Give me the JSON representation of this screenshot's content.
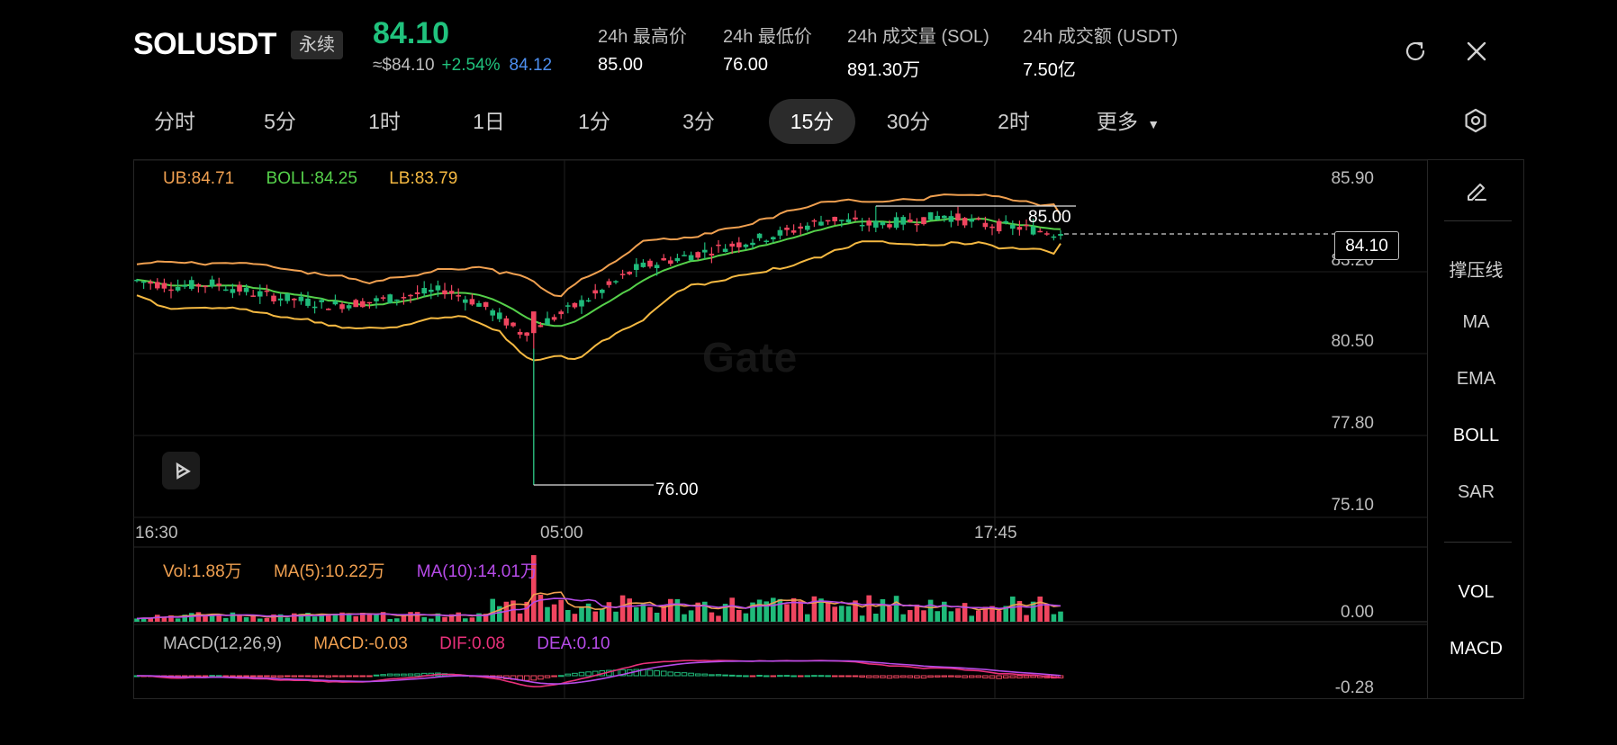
{
  "header": {
    "symbol": "SOLUSDT",
    "contract_type": "永续",
    "last_price": "84.10",
    "usd_price": "≈$84.10",
    "change_pct": "+2.54%",
    "mark_price": "84.12",
    "stats": [
      {
        "label": "24h 最高价",
        "value": "85.00"
      },
      {
        "label": "24h 最低价",
        "value": "76.00"
      },
      {
        "label": "24h 成交量 (SOL)",
        "value": "891.30万"
      },
      {
        "label": "24h 成交额 (USDT)",
        "value": "7.50亿"
      }
    ],
    "icons": [
      "rotate-icon",
      "close-icon"
    ]
  },
  "intervals": [
    "分时",
    "5分",
    "1时",
    "1日",
    "1分",
    "3分",
    "15分",
    "30分",
    "2时",
    "更多"
  ],
  "active_interval": "15分",
  "settings_icon": "hexagon-gear-icon",
  "indicator_panel": {
    "edit_icon": "pencil-icon",
    "main": [
      "撑压线",
      "MA",
      "EMA",
      "BOLL",
      "SAR"
    ],
    "main_active": "BOLL",
    "sub": [
      "VOL",
      "MACD"
    ]
  },
  "main_chart": {
    "legend": {
      "ub": "UB:84.71",
      "boll": "BOLL:84.25",
      "lb": "LB:83.79"
    },
    "y_ticks": [
      "85.90",
      "83.20",
      "80.50",
      "77.80",
      "75.10"
    ],
    "x_ticks": [
      "16:30",
      "05:00",
      "17:45"
    ],
    "last_price_tag": "84.10",
    "high_label": "85.00",
    "low_label": "76.00",
    "watermark": "Gate"
  },
  "volume_panel": {
    "legend": {
      "vol": "Vol:1.88万",
      "ma5": "MA(5):10.22万",
      "ma10": "MA(10):14.01万"
    },
    "y_tick": "0.00"
  },
  "macd_panel": {
    "legend": {
      "title": "MACD(12,26,9)",
      "macd": "MACD:-0.03",
      "dif": "DIF:0.08",
      "dea": "DEA:0.10"
    },
    "y_tick": "-0.28"
  },
  "colors": {
    "up": "#1fba7a",
    "down": "#f0455f",
    "ub": "#f0a050",
    "boll": "#55d04a",
    "lb": "#f5b942",
    "ma10": "#b64be8",
    "dif": "#e8307a"
  },
  "chart_data": {
    "type": "candlestick",
    "ylim": [
      75.1,
      85.9
    ],
    "key_points": [
      {
        "label": "high",
        "value": 85.0
      },
      {
        "label": "low",
        "value": 76.0
      },
      {
        "label": "last",
        "value": 84.1
      }
    ],
    "boll_last": {
      "ub": 84.71,
      "mid": 84.25,
      "lb": 83.79
    },
    "close_trend": [
      82.6,
      82.4,
      82.5,
      82.2,
      82.0,
      81.8,
      81.9,
      82.1,
      82.3,
      81.8,
      80.9,
      81.5,
      82.2,
      83.0,
      83.3,
      83.6,
      83.9,
      84.2,
      84.6,
      84.4,
      84.5,
      84.7,
      84.4,
      84.3,
      84.1
    ]
  }
}
